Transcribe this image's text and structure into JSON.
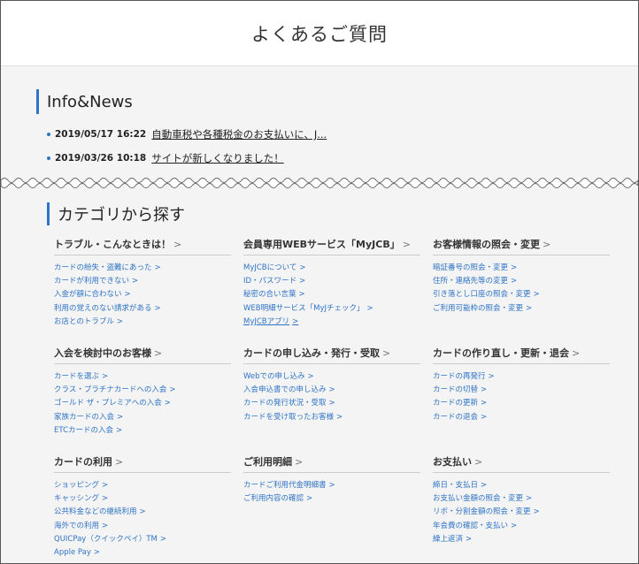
{
  "page_title": "よくあるご質問",
  "info_news": {
    "title": "Info&News",
    "items": [
      {
        "date": "2019/05/17 16:22",
        "text": "自動車税や各種税金のお支払いに、J..."
      },
      {
        "date": "2019/03/26 10:18",
        "text": "サイトが新しくなりました！"
      }
    ]
  },
  "category": {
    "title": "カテゴリから探す",
    "chev": ">",
    "groups": [
      {
        "title": "トラブル・こんなときは！",
        "links": [
          "カードの紛失・盗難にあった",
          "カードが利用できない",
          "入金が額に合わない",
          "利用の覚えのない請求がある",
          "お店とのトラブル"
        ]
      },
      {
        "title": "会員専用WEBサービス「MyJCB」",
        "links": [
          "MyJCBについて",
          "ID・パスワード",
          "秘密の合い言葉",
          "WEB明細サービス「MyJチェック」",
          "MyJCBアプリ"
        ]
      },
      {
        "title": "お客様情報の照会・変更",
        "links": [
          "暗証番号の照会・変更",
          "住所・連絡先等の変更",
          "引き落とし口座の照会・変更",
          "ご利用可能枠の照会・変更"
        ]
      },
      {
        "title": "入会を検討中のお客様",
        "links": [
          "カードを選ぶ",
          "クラス・プラチナカードへの入会",
          "ゴールド ザ・プレミアへの入会",
          "家族カードの入会",
          "ETCカードの入会"
        ]
      },
      {
        "title": "カードの申し込み・発行・受取",
        "links": [
          "Webでの申し込み",
          "入会申込書での申し込み",
          "カードの発行状況・受取",
          "カードを受け取ったお客様"
        ]
      },
      {
        "title": "カードの作り直し・更新・退会",
        "links": [
          "カードの再発行",
          "カードの切替",
          "カードの更新",
          "カードの退会"
        ]
      },
      {
        "title": "カードの利用",
        "links": [
          "ショッピング",
          "キャッシング",
          "公共料金などの継続利用",
          "海外での利用",
          "QUICPay（クイックペイ）TM",
          "Apple Pay"
        ]
      },
      {
        "title": "ご利用明細",
        "links": [
          "カードご利用代金明細書",
          "ご利用内容の確認"
        ]
      },
      {
        "title": "お支払い",
        "links": [
          "締日・支払日",
          "お支払い金額の照会・変更",
          "リボ・分割金額の照会・変更",
          "年会費の確認・支払い",
          "繰上返済"
        ]
      }
    ]
  },
  "colors": {
    "accent": "#2e73c6",
    "background": "#f4f4f4"
  }
}
